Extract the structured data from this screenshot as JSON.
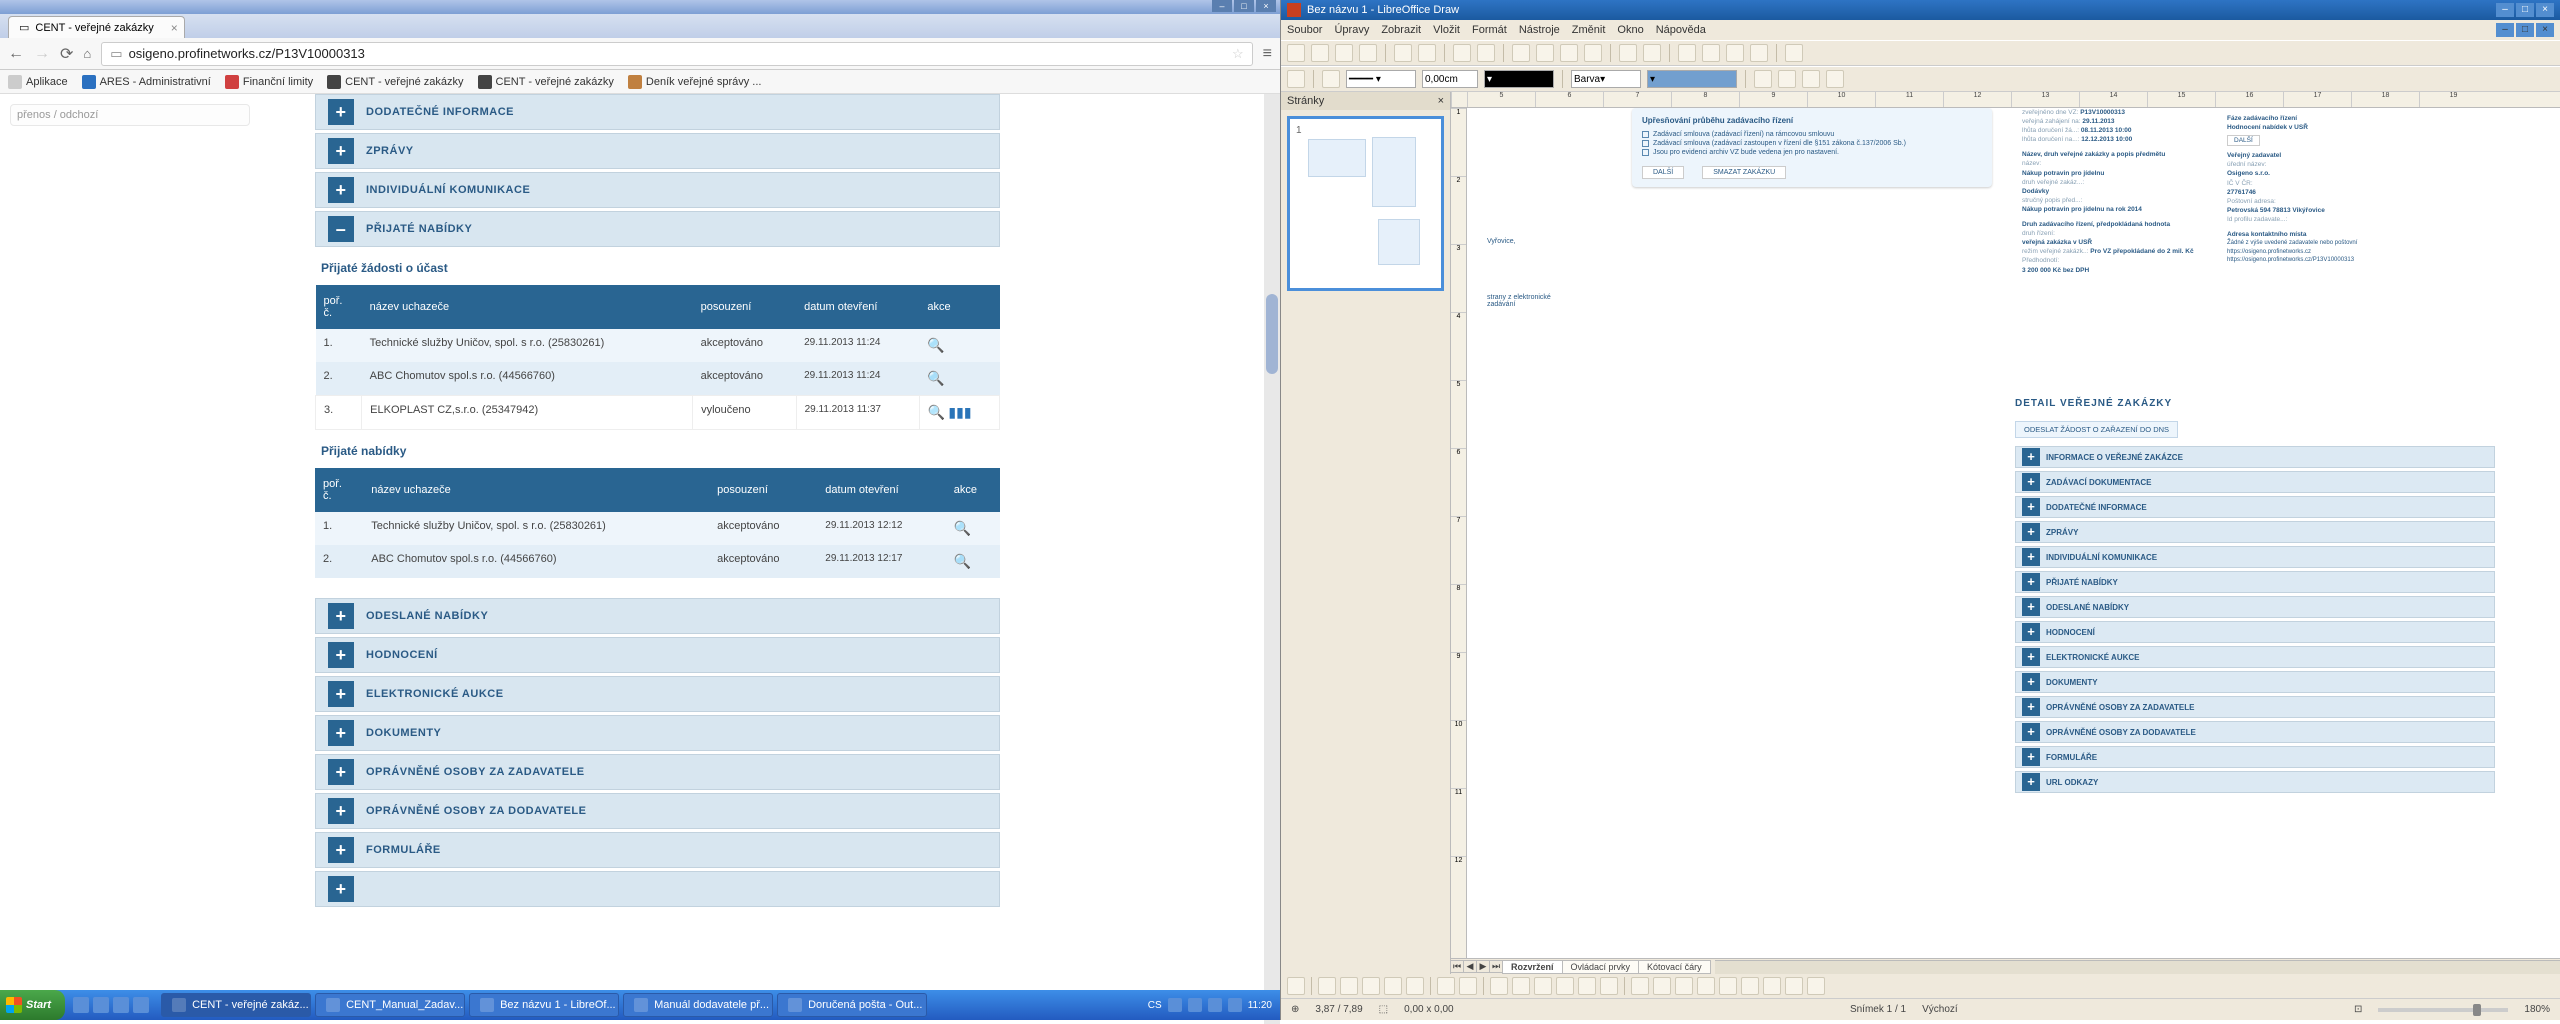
{
  "chrome": {
    "tab_title": "CENT - veřejné zakázky",
    "url": "osigeno.profinetworks.cz/P13V10000313",
    "bookmarks": [
      "Aplikace",
      "ARES - Administrativní",
      "Finanční limity",
      "CENT - veřejné zakázky",
      "CENT - veřejné zakázky",
      "Deník veřejné správy ..."
    ],
    "sidebar_text": "přenos / odchozí",
    "sections_top": [
      "DODATEČNÉ INFORMACE",
      "ZPRÁVY",
      "INDIVIDUÁLNÍ KOMUNIKACE",
      "PŘIJATÉ NABÍDKY"
    ],
    "sub1": "Přijaté žádosti o účast",
    "cols": {
      "c1": "poř.\nč.",
      "c2": "název uchazeče",
      "c3": "posouzení",
      "c4": "datum otevření",
      "c5": "akce"
    },
    "rows1": [
      {
        "n": "1.",
        "name": "Technické služby Uničov, spol. s r.o. (25830261)",
        "p": "akceptováno",
        "d": "29.11.2013 11:24"
      },
      {
        "n": "2.",
        "name": "ABC Chomutov spol.s r.o. (44566760)",
        "p": "akceptováno",
        "d": "29.11.2013 11:24"
      },
      {
        "n": "3.",
        "name": "ELKOPLAST CZ,s.r.o. (25347942)",
        "p": "vyloučeno",
        "d": "29.11.2013 11:37"
      }
    ],
    "sub2": "Přijaté nabídky",
    "rows2": [
      {
        "n": "1.",
        "name": "Technické služby Uničov, spol. s r.o. (25830261)",
        "p": "akceptováno",
        "d": "29.11.2013 12:12"
      },
      {
        "n": "2.",
        "name": "ABC Chomutov spol.s r.o. (44566760)",
        "p": "akceptováno",
        "d": "29.11.2013 12:17"
      }
    ],
    "sections_bottom": [
      "ODESLANÉ NABÍDKY",
      "HODNOCENÍ",
      "ELEKTRONICKÉ AUKCE",
      "DOKUMENTY",
      "OPRÁVNĚNÉ OSOBY ZA ZADAVATELE",
      "OPRÁVNĚNÉ OSOBY ZA DODAVATELE",
      "FORMULÁŘE"
    ]
  },
  "taskbar": {
    "start": "Start",
    "items": [
      "CENT - veřejné zakáz...",
      "CENT_Manual_Zadav...",
      "Bez názvu 1 - LibreOf...",
      "Manuál dodavatele př...",
      "Doručená pošta - Out..."
    ],
    "lang": "CS",
    "clock": "11:20"
  },
  "lodraw": {
    "title": "Bez názvu 1 - LibreOffice Draw",
    "menu": [
      "Soubor",
      "Úpravy",
      "Zobrazit",
      "Vložit",
      "Formát",
      "Nástroje",
      "Změnit",
      "Okno",
      "Nápověda"
    ],
    "linewidth": "0,00cm",
    "color": "Barva",
    "slides_hdr": "Stránky",
    "ruler_h": [
      "5",
      "6",
      "7",
      "8",
      "9",
      "10",
      "11",
      "12",
      "13",
      "14",
      "15",
      "16",
      "17",
      "18",
      "19"
    ],
    "ruler_v": [
      "1",
      "2",
      "3",
      "4",
      "5",
      "6",
      "7",
      "8",
      "9",
      "10",
      "11",
      "12"
    ],
    "proc": {
      "title": "Upřesňování průběhu zadávacího řízení",
      "items": [
        "Zadávací smlouva (zadávací řízení) na rámcovou smlouvu",
        "Zadávací smlouva (zadávací zastoupen v řízení dle §151 zákona č.137/2006 Sb.)",
        "Jsou pro evidenci archiv VZ bude vedena jen pro nastavení."
      ],
      "btn1": "DALŠÍ",
      "btn2": "SMAZAT ZAKÁZKU"
    },
    "info_left": {
      "evid1_lbl": "zveřejněno dne VZ:",
      "evid1_v": "P13V10000313",
      "date1_lbl": "veřejná zahájení na:",
      "date1_v": "29.11.2013",
      "date2_lbl": "lhůta doručení žá...:",
      "date2_v": "08.11.2013 10:00",
      "date3_lbl": "lhůta doručení na...:",
      "date3_v": "12.12.2013 10:00",
      "h1": "Název, druh veřejné zakázky a popis předmětu",
      "h2_lbl": "název:",
      "h2_v": "Nákup potravin pro jídelnu",
      "druh_lbl": "druh veřejné zakáz...:",
      "druh_v": "Dodávky",
      "popis_lbl": "stručný popis před...:",
      "popis_v": "Nákup potravin pro jídelnu na rok 2014",
      "h3": "Druh zadávacího řízení, předpokládaná hodnota",
      "druh2_lbl": "druh řízení:",
      "druh2_v": "veřejná zakázka v USŘ",
      "rezim_lbl": "režim veřejné zakázk..:",
      "rezim_v": "Pro VZ přepokládané do 2 mil. Kč",
      "predhod_lbl": "Předhodnotí:",
      "predhod_v": "3 200 000 Kč bez DPH"
    },
    "info_right": {
      "h1": "Fáze zadávacího řízení",
      "h1b": "Hodnocení nabídek v USŘ",
      "btn": "DALŠÍ",
      "h2": "Veřejný zadavatel",
      "h2a_lbl": "úřední název:",
      "h2a_v": "Osigeno s.r.o.",
      "h2b_lbl": "IČ V ČR:",
      "h2b_v": "27761746",
      "h2c_lbl": "Poštovní adresa:",
      "h2c_v": "Petrovská 594 78813 Vikýřovice",
      "h2d_lbl": "Id profilu zadavate...:",
      "h3": "Adresa kontaktního místa",
      "h3v": "Žádné z výše uvedené zadavatele nebo poštovní\nhttps://osigeno.profinetworks.cz\nhttps://osigeno.profinetworks.cz/P13V10000313"
    },
    "detail": {
      "title": "DETAIL VEŘEJNÉ ZAKÁZKY",
      "mainbtn": "ODESLAT ŽÁDOST O ZAŘAZENÍ DO DNS",
      "rows": [
        "INFORMACE O VEŘEJNÉ ZAKÁZCE",
        "ZADÁVACÍ DOKUMENTACE",
        "DODATEČNÉ INFORMACE",
        "ZPRÁVY",
        "INDIVIDUÁLNÍ KOMUNIKACE",
        "PŘIJATÉ NABÍDKY",
        "ODESLANÉ NABÍDKY",
        "HODNOCENÍ",
        "ELEKTRONICKÉ AUKCE",
        "DOKUMENTY",
        "OPRÁVNĚNÉ OSOBY ZA ZADAVATELE",
        "OPRÁVNĚNÉ OSOBY ZA DODAVATELE",
        "FORMULÁŘE",
        "URL ODKAZY"
      ]
    },
    "tabs_bottom": [
      "Rozvržení",
      "Ovládací prvky",
      "Kótovací čáry"
    ],
    "status": {
      "pos": "3,87 / 7,89",
      "size": "0,00 x 0,00",
      "slide": "Snímek 1 / 1",
      "style": "Výchozí",
      "zoom": "180%"
    }
  }
}
